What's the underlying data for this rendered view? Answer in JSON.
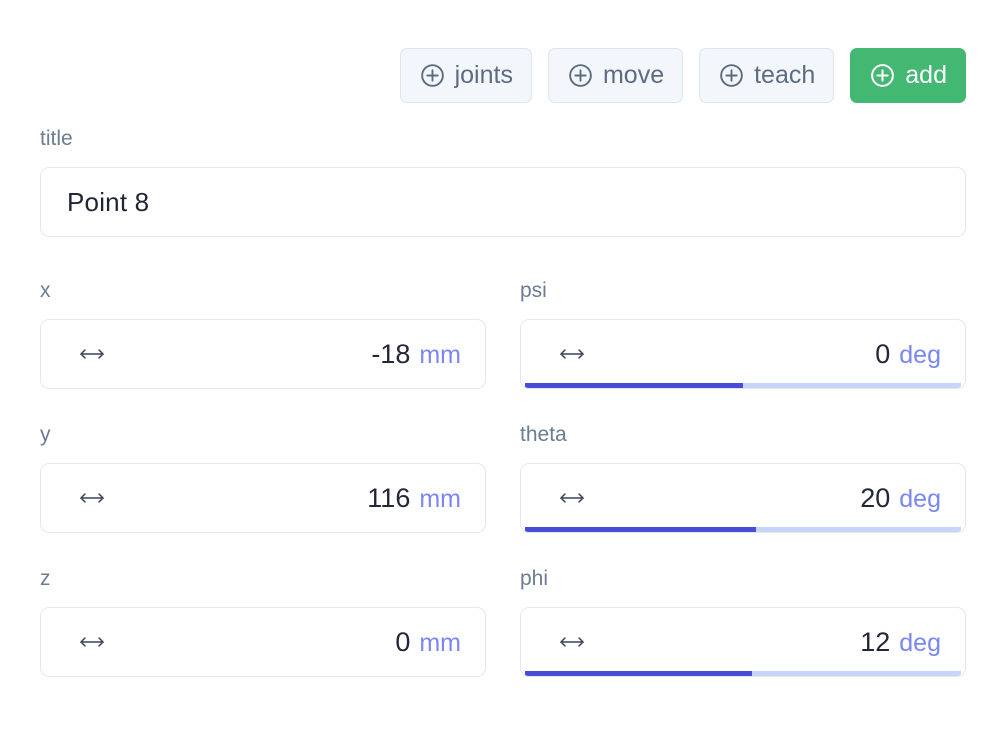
{
  "toolbar": {
    "buttons": [
      {
        "label": "joints",
        "icon": "plus-circle-icon",
        "style": "outline"
      },
      {
        "label": "move",
        "icon": "plus-circle-icon",
        "style": "outline"
      },
      {
        "label": "teach",
        "icon": "plus-circle-icon",
        "style": "outline"
      },
      {
        "label": "add",
        "icon": "plus-circle-icon",
        "style": "primary"
      }
    ],
    "primary_color": "#43b873",
    "outline_bg": "#f3f7fb",
    "outline_text": "#5d6c82"
  },
  "form": {
    "title_field": {
      "label": "title",
      "value": "Point 8"
    },
    "fields": [
      {
        "name": "x",
        "label": "x",
        "value": "-18",
        "unit": "mm",
        "icon": "left-right-arrow-icon",
        "has_progress": false,
        "progress_percent": 0
      },
      {
        "name": "psi",
        "label": "psi",
        "value": "0",
        "unit": "deg",
        "icon": "left-right-arrow-icon",
        "has_progress": true,
        "progress_percent": 50
      },
      {
        "name": "y",
        "label": "y",
        "value": "116",
        "unit": "mm",
        "icon": "left-right-arrow-icon",
        "has_progress": false,
        "progress_percent": 0
      },
      {
        "name": "theta",
        "label": "theta",
        "value": "20",
        "unit": "deg",
        "icon": "left-right-arrow-icon",
        "has_progress": true,
        "progress_percent": 53
      },
      {
        "name": "z",
        "label": "z",
        "value": "0",
        "unit": "mm",
        "icon": "left-right-arrow-icon",
        "has_progress": false,
        "progress_percent": 0
      },
      {
        "name": "phi",
        "label": "phi",
        "value": "12",
        "unit": "deg",
        "icon": "left-right-arrow-icon",
        "has_progress": true,
        "progress_percent": 52
      }
    ],
    "label_color": "#6b7c93",
    "value_color": "#232838",
    "unit_color": "#7b87f0",
    "progress_fill_color": "#4a4cd8",
    "progress_track_color": "#c6d5f8"
  }
}
